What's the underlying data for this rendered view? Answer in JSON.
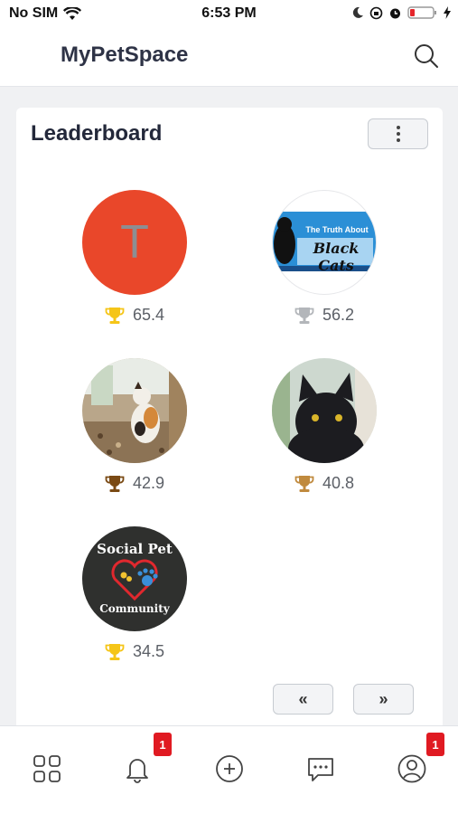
{
  "status_bar": {
    "carrier": "No SIM",
    "time": "6:53 PM"
  },
  "header": {
    "title": "MyPetSpace"
  },
  "leaderboard": {
    "title": "Leaderboard",
    "entries": [
      {
        "avatar_type": "initial",
        "initial": "T",
        "avatar_color": "#e9472a",
        "trophy": "gold",
        "score": "65.4"
      },
      {
        "avatar_type": "photo",
        "photo_text_1": "The Truth About",
        "photo_text_2": "Black Cats",
        "trophy": "silver",
        "score": "56.2"
      },
      {
        "avatar_type": "photo",
        "trophy": "bronze",
        "score": "42.9"
      },
      {
        "avatar_type": "photo",
        "trophy": "bronze",
        "score": "40.8"
      },
      {
        "avatar_type": "logo",
        "logo_line_1": "Social Pet",
        "logo_line_2": "Community",
        "trophy": "gold",
        "score": "34.5"
      }
    ],
    "pagination": {
      "prev": "«",
      "next": "»"
    }
  },
  "bottom_nav": {
    "items": [
      {
        "name": "apps"
      },
      {
        "name": "notifications",
        "badge": "1"
      },
      {
        "name": "add"
      },
      {
        "name": "messages"
      },
      {
        "name": "profile",
        "badge": "1"
      }
    ]
  },
  "colors": {
    "gold": "#f5c518",
    "silver": "#b3b6ba",
    "bronze": "#7a4a14",
    "bronze_light": "#c08a3e",
    "badge": "#e01a22"
  }
}
